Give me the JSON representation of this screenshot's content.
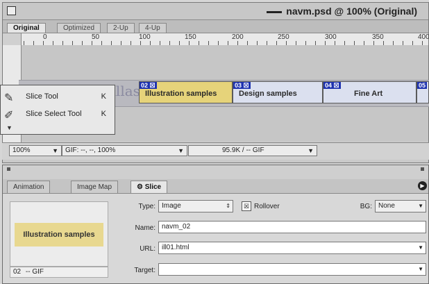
{
  "window": {
    "title": "navm.psd @ 100% (Original)",
    "tabs": [
      "Original",
      "Optimized",
      "2-Up",
      "4-Up"
    ]
  },
  "ruler": {
    "labels": [
      "0",
      "50",
      "100",
      "150",
      "200",
      "250",
      "300",
      "350",
      "400"
    ]
  },
  "canvas": {
    "gallery_text": "allas",
    "slices": [
      {
        "badge": "02 ☒",
        "label": "Illustration samples"
      },
      {
        "badge": "03 ☒",
        "label": "Design samples"
      },
      {
        "badge": "04 ☒",
        "label": "Fine Art"
      },
      {
        "badge": "05",
        "label": ""
      }
    ]
  },
  "flyout": {
    "items": [
      {
        "label": "Slice Tool",
        "shortcut": "K"
      },
      {
        "label": "Slice Select Tool",
        "shortcut": "K"
      }
    ]
  },
  "status": {
    "zoom": "100%",
    "optimization": "GIF: --, --, 100%",
    "size": "95.9K / -- GIF"
  },
  "palette": {
    "tabs": [
      "Animation",
      "Image Map",
      "Slice"
    ],
    "preview": {
      "label": "Illustration samples",
      "slice_number": "02",
      "format": "-- GIF"
    },
    "fields": {
      "type_label": "Type:",
      "type_value": "Image",
      "rollover_label": "Rollover",
      "bg_label": "BG:",
      "bg_value": "None",
      "name_label": "Name:",
      "name_value": "navm_02",
      "url_label": "URL:",
      "url_value": "ill01.html",
      "target_label": "Target:",
      "target_value": ""
    }
  }
}
